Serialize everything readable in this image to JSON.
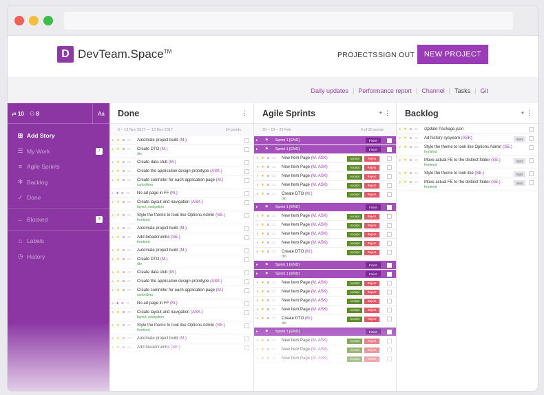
{
  "header": {
    "logo_letter": "D",
    "logo_text": "DevTeam.Space",
    "logo_tm": "TM",
    "nav_projects": "PROJECTS",
    "nav_signout": "SIGN OUT",
    "new_project": "NEW PROJECT"
  },
  "subnav": [
    "Daily updates",
    "Performance report",
    "Channel",
    "Tasks",
    "Git"
  ],
  "sidebar": {
    "stat_a": "10",
    "stat_b": "8",
    "font_toggle": "Aa",
    "items": [
      {
        "label": "Add Story",
        "icon": "plus-square-icon"
      },
      {
        "label": "My Work",
        "icon": "checklist-icon",
        "count": "7"
      },
      {
        "label": "Agile Sprints",
        "icon": "list-icon"
      },
      {
        "label": "Backlog",
        "icon": "asterisk-icon"
      },
      {
        "label": "Done",
        "icon": "check-icon"
      },
      {
        "label": "Blocked",
        "icon": "arrow-left-icon",
        "count": "3"
      },
      {
        "label": "Labels",
        "icon": "tag-icon"
      },
      {
        "label": "History",
        "icon": "clock-icon"
      }
    ]
  },
  "done": {
    "title": "Done",
    "meta_left": "6 – 13 Nov 2017 — 13 Nov 2017",
    "meta_right": "54 points",
    "rows": [
      {
        "text": "Automate project build",
        "assignee": "(M.)",
        "tag": ""
      },
      {
        "text": "Create DTO",
        "assignee": "(M.)",
        "tag": "dto"
      },
      {
        "text": "Create data stub",
        "assignee": "(M.)",
        "tag": ""
      },
      {
        "text": "Create the application design prototype",
        "assignee": "(ASK.)",
        "tag": ""
      },
      {
        "text": "Create controller for each application page",
        "assignee": "(M.)",
        "tag": "controllers"
      },
      {
        "text": "No ad page in FF",
        "assignee": "(M.)",
        "tag": "",
        "red": true
      },
      {
        "text": "Create layout and navigation",
        "assignee": "(ASK.)",
        "tag": "layout, navigation"
      },
      {
        "text": "Style the theme to look like Options Admin",
        "assignee": "(SE.)",
        "tag": "frontend"
      },
      {
        "text": "Automate project build",
        "assignee": "(M.)",
        "tag": ""
      },
      {
        "text": "Add breadcrumbs",
        "assignee": "(SE.)",
        "tag": "frontend"
      },
      {
        "text": "Automate project build",
        "assignee": "(M.)",
        "tag": ""
      },
      {
        "text": "Create DTO",
        "assignee": "(M.)",
        "tag": "dto"
      },
      {
        "text": "Create data stub",
        "assignee": "(M.)",
        "tag": ""
      },
      {
        "text": "Create the application design prototype",
        "assignee": "(ASK.)",
        "tag": ""
      },
      {
        "text": "Create controller for each application page",
        "assignee": "(M.)",
        "tag": "controllers"
      },
      {
        "text": "No ad page in FF",
        "assignee": "(M.)",
        "tag": "",
        "red": true
      },
      {
        "text": "Create layout and navigation",
        "assignee": "(ASK.)",
        "tag": "layout, navigation"
      },
      {
        "text": "Style the theme to look like Options Admin",
        "assignee": "(SE.)",
        "tag": "frontend"
      },
      {
        "text": "Automate project build",
        "assignee": "(M.)",
        "tag": ""
      },
      {
        "text": "Add breadcrumbs",
        "assignee": "(SE.)",
        "tag": ""
      }
    ]
  },
  "agile": {
    "title": "Agile Sprints",
    "meta_left": "20 – 19 – 25 Feb",
    "meta_right": "0 of 28 points",
    "sprint_label": "Sprint 1 [END]",
    "finish": "Finish",
    "accept": "Accept",
    "reject": "Reject",
    "item_text": "New Item Page",
    "item_assignee": "(M. ASK)",
    "dto_text": "Create DTO",
    "dto_assignee": "(M.)",
    "dto_tag": "dto"
  },
  "backlog": {
    "title": "Backlog",
    "start": "Start",
    "rows": [
      {
        "text": "Update Package.json",
        "assignee": "",
        "tag": "",
        "italic": true
      },
      {
        "text": "Ad history sysyeam",
        "assignee": "(ASK)",
        "tag": "",
        "start": true
      },
      {
        "text": "Style the theme to look like Options Admin",
        "assignee": "(SE.)",
        "tag": "frontend"
      },
      {
        "text": "Move actual FE to the distinct folder",
        "assignee": "(SE.)",
        "tag": "frontend",
        "start": true
      },
      {
        "text": "Style the theme to look like",
        "assignee": "(SE.)",
        "tag": "",
        "start": true
      },
      {
        "text": "Move actual FE to the distinct folder",
        "assignee": "(SE.)",
        "tag": "frontend",
        "start": true
      }
    ]
  },
  "colors": {
    "brand": "#8c36a4",
    "accept": "#5f8c2a",
    "reject": "#e15a67"
  }
}
